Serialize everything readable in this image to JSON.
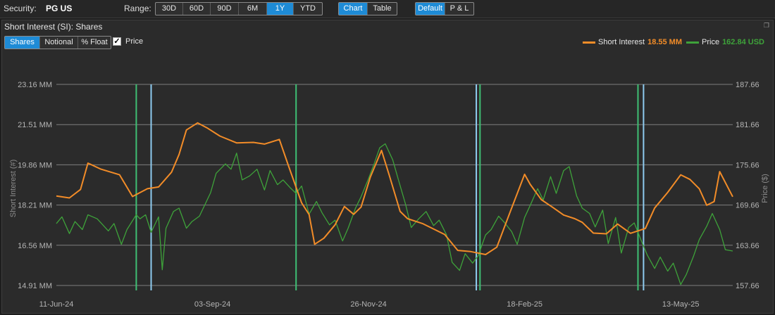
{
  "toolbar": {
    "security_label": "Security:",
    "security_value": "PG US",
    "range_label": "Range:",
    "range_buttons": [
      "30D",
      "60D",
      "90D",
      "6M",
      "1Y",
      "YTD"
    ],
    "range_active": "1Y",
    "view_buttons": [
      "Chart",
      "Table"
    ],
    "view_active": "Chart",
    "mode_buttons": [
      "Default",
      "P & L"
    ],
    "mode_active": "Default"
  },
  "panel": {
    "title": "Short Interest (SI): Shares",
    "corner_icon": "restore-icon",
    "si_buttons": [
      "Shares",
      "Notional",
      "% Float"
    ],
    "si_active": "Shares",
    "price_checkbox_label": "Price",
    "price_checked": true
  },
  "legend": {
    "short_interest_label": "Short Interest",
    "short_interest_value": "18.55 MM",
    "price_label": "Price",
    "price_value": "162.84 USD"
  },
  "colors": {
    "short_interest": "#f28c28",
    "price": "#3ea23a",
    "green_marker": "#3fbf74",
    "blue_marker": "#8ecbf0",
    "active_button": "#1e8bd6"
  },
  "chart_data": {
    "type": "line",
    "ylabel_left": "Short Interest (#)",
    "ylabel_right": "Price ($)",
    "left_ticks": [
      "23.16 MM",
      "21.51 MM",
      "19.86 MM",
      "18.21 MM",
      "16.56 MM",
      "14.91 MM"
    ],
    "right_ticks": [
      "187.66",
      "181.66",
      "175.66",
      "169.66",
      "163.66",
      "157.66"
    ],
    "left_range": [
      14.91,
      23.16
    ],
    "right_range": [
      157.66,
      187.66
    ],
    "x_range": [
      "2024-06-11",
      "2025-06-10"
    ],
    "x_ticks": [
      {
        "date": "2024-06-11",
        "label": "11-Jun-24"
      },
      {
        "date": "2024-09-03",
        "label": "03-Sep-24"
      },
      {
        "date": "2024-11-26",
        "label": "26-Nov-24"
      },
      {
        "date": "2025-02-18",
        "label": "18-Feb-25"
      },
      {
        "date": "2025-05-13",
        "label": "13-May-25"
      }
    ],
    "grid": "horizontal",
    "legend_position": "top-right",
    "series": [
      {
        "name": "Short Interest",
        "unit": "MM",
        "axis": "left",
        "points": [
          [
            "2024-06-11",
            18.58
          ],
          [
            "2024-06-18",
            18.5
          ],
          [
            "2024-06-24",
            18.85
          ],
          [
            "2024-06-28",
            19.93
          ],
          [
            "2024-07-05",
            19.68
          ],
          [
            "2024-07-15",
            19.45
          ],
          [
            "2024-07-22",
            18.56
          ],
          [
            "2024-07-30",
            18.88
          ],
          [
            "2024-08-05",
            18.95
          ],
          [
            "2024-08-12",
            19.56
          ],
          [
            "2024-08-16",
            20.28
          ],
          [
            "2024-08-20",
            21.29
          ],
          [
            "2024-08-26",
            21.58
          ],
          [
            "2024-08-31",
            21.38
          ],
          [
            "2024-09-07",
            21.04
          ],
          [
            "2024-09-16",
            20.76
          ],
          [
            "2024-09-25",
            20.78
          ],
          [
            "2024-10-01",
            20.71
          ],
          [
            "2024-10-09",
            20.9
          ],
          [
            "2024-10-14",
            19.8
          ],
          [
            "2024-10-21",
            18.3
          ],
          [
            "2024-10-25",
            17.82
          ],
          [
            "2024-10-28",
            16.6
          ],
          [
            "2024-11-02",
            16.85
          ],
          [
            "2024-11-08",
            17.4
          ],
          [
            "2024-11-13",
            18.15
          ],
          [
            "2024-11-18",
            17.83
          ],
          [
            "2024-11-22",
            18.13
          ],
          [
            "2024-11-27",
            19.36
          ],
          [
            "2024-12-03",
            20.45
          ],
          [
            "2024-12-07",
            19.47
          ],
          [
            "2024-12-13",
            17.95
          ],
          [
            "2024-12-17",
            17.65
          ],
          [
            "2024-12-25",
            17.45
          ],
          [
            "2025-01-06",
            17.0
          ],
          [
            "2025-01-13",
            16.35
          ],
          [
            "2025-01-20",
            16.3
          ],
          [
            "2025-01-28",
            16.18
          ],
          [
            "2025-02-03",
            16.48
          ],
          [
            "2025-02-10",
            17.88
          ],
          [
            "2025-02-18",
            19.47
          ],
          [
            "2025-02-21",
            19.06
          ],
          [
            "2025-02-27",
            18.43
          ],
          [
            "2025-03-05",
            18.12
          ],
          [
            "2025-03-11",
            17.8
          ],
          [
            "2025-03-17",
            17.65
          ],
          [
            "2025-03-21",
            17.5
          ],
          [
            "2025-03-27",
            17.06
          ],
          [
            "2025-04-03",
            17.03
          ],
          [
            "2025-04-09",
            17.43
          ],
          [
            "2025-04-16",
            17.05
          ],
          [
            "2025-04-24",
            17.25
          ],
          [
            "2025-04-29",
            18.09
          ],
          [
            "2025-05-06",
            18.73
          ],
          [
            "2025-05-13",
            19.45
          ],
          [
            "2025-05-18",
            19.26
          ],
          [
            "2025-05-23",
            18.88
          ],
          [
            "2025-05-27",
            18.2
          ],
          [
            "2025-05-31",
            18.35
          ],
          [
            "2025-06-03",
            19.58
          ],
          [
            "2025-06-10",
            18.55
          ]
        ]
      },
      {
        "name": "Price",
        "unit": "USD",
        "axis": "right",
        "points": [
          [
            "2024-06-11",
            166.9
          ],
          [
            "2024-06-14",
            167.9
          ],
          [
            "2024-06-18",
            165.4
          ],
          [
            "2024-06-21",
            167.2
          ],
          [
            "2024-06-25",
            166.0
          ],
          [
            "2024-06-28",
            168.2
          ],
          [
            "2024-07-03",
            167.6
          ],
          [
            "2024-07-09",
            165.8
          ],
          [
            "2024-07-12",
            166.9
          ],
          [
            "2024-07-16",
            163.8
          ],
          [
            "2024-07-19",
            166.0
          ],
          [
            "2024-07-24",
            168.2
          ],
          [
            "2024-07-26",
            167.6
          ],
          [
            "2024-07-29",
            168.2
          ],
          [
            "2024-08-01",
            165.6
          ],
          [
            "2024-08-05",
            167.9
          ],
          [
            "2024-08-07",
            160.0
          ],
          [
            "2024-08-09",
            166.2
          ],
          [
            "2024-08-13",
            168.7
          ],
          [
            "2024-08-16",
            169.2
          ],
          [
            "2024-08-20",
            166.2
          ],
          [
            "2024-08-23",
            167.2
          ],
          [
            "2024-08-27",
            168.0
          ],
          [
            "2024-09-02",
            171.5
          ],
          [
            "2024-09-05",
            174.4
          ],
          [
            "2024-09-10",
            175.8
          ],
          [
            "2024-09-13",
            175.0
          ],
          [
            "2024-09-16",
            177.4
          ],
          [
            "2024-09-19",
            173.4
          ],
          [
            "2024-09-23",
            174.0
          ],
          [
            "2024-09-27",
            175.0
          ],
          [
            "2024-10-01",
            171.9
          ],
          [
            "2024-10-04",
            174.8
          ],
          [
            "2024-10-08",
            172.7
          ],
          [
            "2024-10-11",
            173.4
          ],
          [
            "2024-10-15",
            172.2
          ],
          [
            "2024-10-18",
            171.4
          ],
          [
            "2024-10-21",
            172.5
          ],
          [
            "2024-10-25",
            168.3
          ],
          [
            "2024-10-29",
            170.2
          ],
          [
            "2024-11-01",
            168.5
          ],
          [
            "2024-11-05",
            166.7
          ],
          [
            "2024-11-08",
            167.4
          ],
          [
            "2024-11-12",
            164.3
          ],
          [
            "2024-11-15",
            166.2
          ],
          [
            "2024-11-19",
            169.2
          ],
          [
            "2024-11-22",
            170.9
          ],
          [
            "2024-11-26",
            173.6
          ],
          [
            "2024-11-29",
            175.8
          ],
          [
            "2024-12-02",
            178.2
          ],
          [
            "2024-12-05",
            178.8
          ],
          [
            "2024-12-09",
            176.4
          ],
          [
            "2024-12-12",
            173.5
          ],
          [
            "2024-12-16",
            169.7
          ],
          [
            "2024-12-19",
            166.3
          ],
          [
            "2024-12-23",
            167.6
          ],
          [
            "2024-12-27",
            168.7
          ],
          [
            "2024-12-31",
            166.6
          ],
          [
            "2025-01-03",
            167.4
          ],
          [
            "2025-01-07",
            165.2
          ],
          [
            "2025-01-10",
            161.1
          ],
          [
            "2025-01-14",
            159.9
          ],
          [
            "2025-01-17",
            162.4
          ],
          [
            "2025-01-21",
            161.0
          ],
          [
            "2025-01-24",
            162.1
          ],
          [
            "2025-01-28",
            165.2
          ],
          [
            "2025-01-31",
            166.0
          ],
          [
            "2025-02-04",
            168.0
          ],
          [
            "2025-02-07",
            167.1
          ],
          [
            "2025-02-11",
            165.7
          ],
          [
            "2025-02-14",
            163.8
          ],
          [
            "2025-02-18",
            167.8
          ],
          [
            "2025-02-21",
            169.6
          ],
          [
            "2025-02-25",
            172.1
          ],
          [
            "2025-02-28",
            170.4
          ],
          [
            "2025-03-04",
            173.9
          ],
          [
            "2025-03-07",
            171.4
          ],
          [
            "2025-03-11",
            174.8
          ],
          [
            "2025-03-14",
            175.4
          ],
          [
            "2025-03-18",
            171.0
          ],
          [
            "2025-03-21",
            169.2
          ],
          [
            "2025-03-25",
            168.4
          ],
          [
            "2025-03-28",
            166.4
          ],
          [
            "2025-04-01",
            168.9
          ],
          [
            "2025-04-04",
            163.9
          ],
          [
            "2025-04-08",
            167.8
          ],
          [
            "2025-04-11",
            162.5
          ],
          [
            "2025-04-15",
            166.3
          ],
          [
            "2025-04-18",
            167.0
          ],
          [
            "2025-04-22",
            164.2
          ],
          [
            "2025-04-25",
            162.2
          ],
          [
            "2025-04-29",
            160.2
          ],
          [
            "2025-05-02",
            161.9
          ],
          [
            "2025-05-06",
            159.8
          ],
          [
            "2025-05-09",
            161.0
          ],
          [
            "2025-05-13",
            157.8
          ],
          [
            "2025-05-16",
            159.3
          ],
          [
            "2025-05-20",
            162.1
          ],
          [
            "2025-05-23",
            164.5
          ],
          [
            "2025-05-27",
            166.5
          ],
          [
            "2025-05-30",
            168.4
          ],
          [
            "2025-06-03",
            166.0
          ],
          [
            "2025-06-06",
            163.0
          ],
          [
            "2025-06-10",
            162.8
          ]
        ]
      }
    ],
    "event_markers": [
      {
        "date": "2024-07-24",
        "color": "green"
      },
      {
        "date": "2024-08-01",
        "color": "blue"
      },
      {
        "date": "2024-10-18",
        "color": "green"
      },
      {
        "date": "2025-01-23",
        "color": "blue"
      },
      {
        "date": "2025-01-25",
        "color": "green"
      },
      {
        "date": "2025-04-20",
        "color": "green"
      },
      {
        "date": "2025-04-23",
        "color": "blue"
      }
    ]
  }
}
